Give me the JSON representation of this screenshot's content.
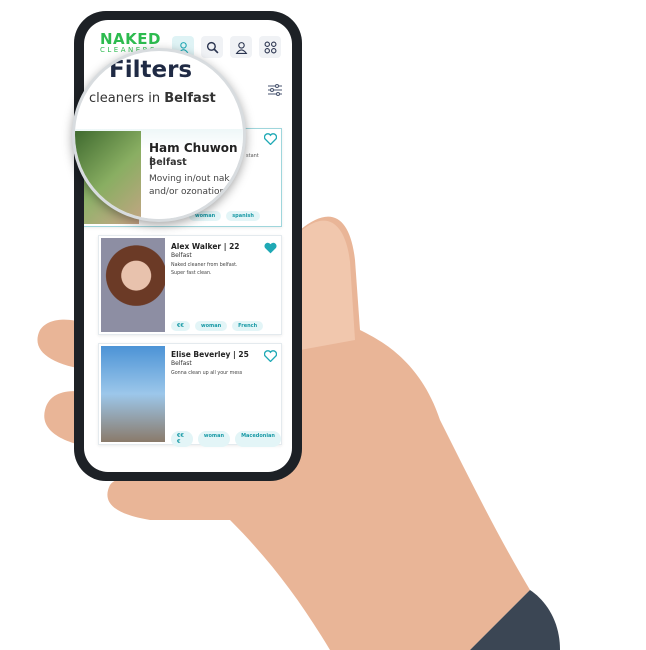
{
  "app": {
    "logo_line1": "NAKED",
    "logo_line2": "CLEANERS"
  },
  "header": {
    "icons": [
      "cleaner-icon",
      "search-icon",
      "user-icon",
      "grid-icon"
    ]
  },
  "page": {
    "title": "Filters",
    "subtitle_prefix": "cleaners in ",
    "subtitle_city": "Belfast"
  },
  "cards": [
    {
      "name": "Ham Chuwon |",
      "city": "Belfast",
      "desc1": "Moving in/out nak",
      "desc2": "and/or ozonation",
      "extra": "stant",
      "tags": [
        "woman",
        "spanish"
      ],
      "favorited": false
    },
    {
      "name": "Alex Walker | 22",
      "city": "Belfast",
      "desc1": "Naked cleaner from belfast.",
      "desc2": "Super fast clean.",
      "tags": [
        "€€",
        "woman",
        "French"
      ],
      "favorited": true
    },
    {
      "name": "Elise Beverley | 25",
      "city": "Belfast",
      "desc1": "Gonna clean up all your mess",
      "desc2": "",
      "tags": [
        "€€€",
        "woman",
        "Macedonian"
      ],
      "favorited": false
    }
  ],
  "colors": {
    "accent": "#1fa9b5",
    "logo": "#2dbb4f",
    "skin": "#eab89a",
    "sleeve": "#3b4654"
  }
}
